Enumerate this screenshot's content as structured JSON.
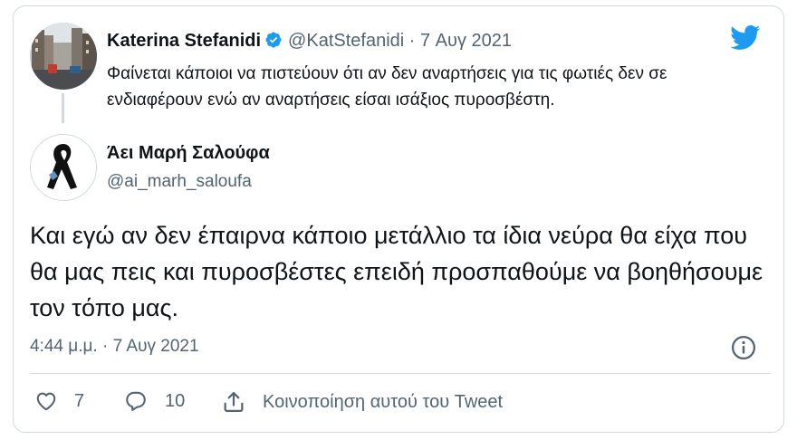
{
  "quoted": {
    "name": "Katerina Stefanidi",
    "handle": "@KatStefanidi",
    "separator": "·",
    "date": "7 Αυγ 2021",
    "text": "Φαίνεται κάποιοι να πιστεύουν ότι αν δεν αναρτήσεις για τις φωτιές δεν σε ενδιαφέρουν ενώ αν αναρτήσεις είσαι ισάξιος πυροσβέστη."
  },
  "reply": {
    "name": "Άει Μαρή Σαλούφα",
    "handle": "@ai_marh_saloufa",
    "text": "Και εγώ αν δεν έπαιρνα κάποιο μετάλλιο τα ίδια νεύρα θα είχα που θα μας πεις και πυροσβέστες επειδή προσπαθούμε να βοηθήσουμε τον τόπο μας.",
    "time": "4:44 μ.μ.",
    "separator": "·",
    "date": "7 Αυγ 2021"
  },
  "actions": {
    "likes": "7",
    "replies": "10",
    "share_label": "Κοινοποίηση αυτού του Tweet"
  },
  "icons": {
    "twitter": "twitter-bird-icon",
    "verified": "verified-badge-icon",
    "info": "info-icon",
    "like": "heart-icon",
    "reply": "speech-bubble-icon",
    "share": "share-upload-icon"
  },
  "colors": {
    "twitter_blue": "#1d9bf0",
    "text": "#0f1419",
    "muted": "#536471",
    "border": "#cfd9de"
  }
}
